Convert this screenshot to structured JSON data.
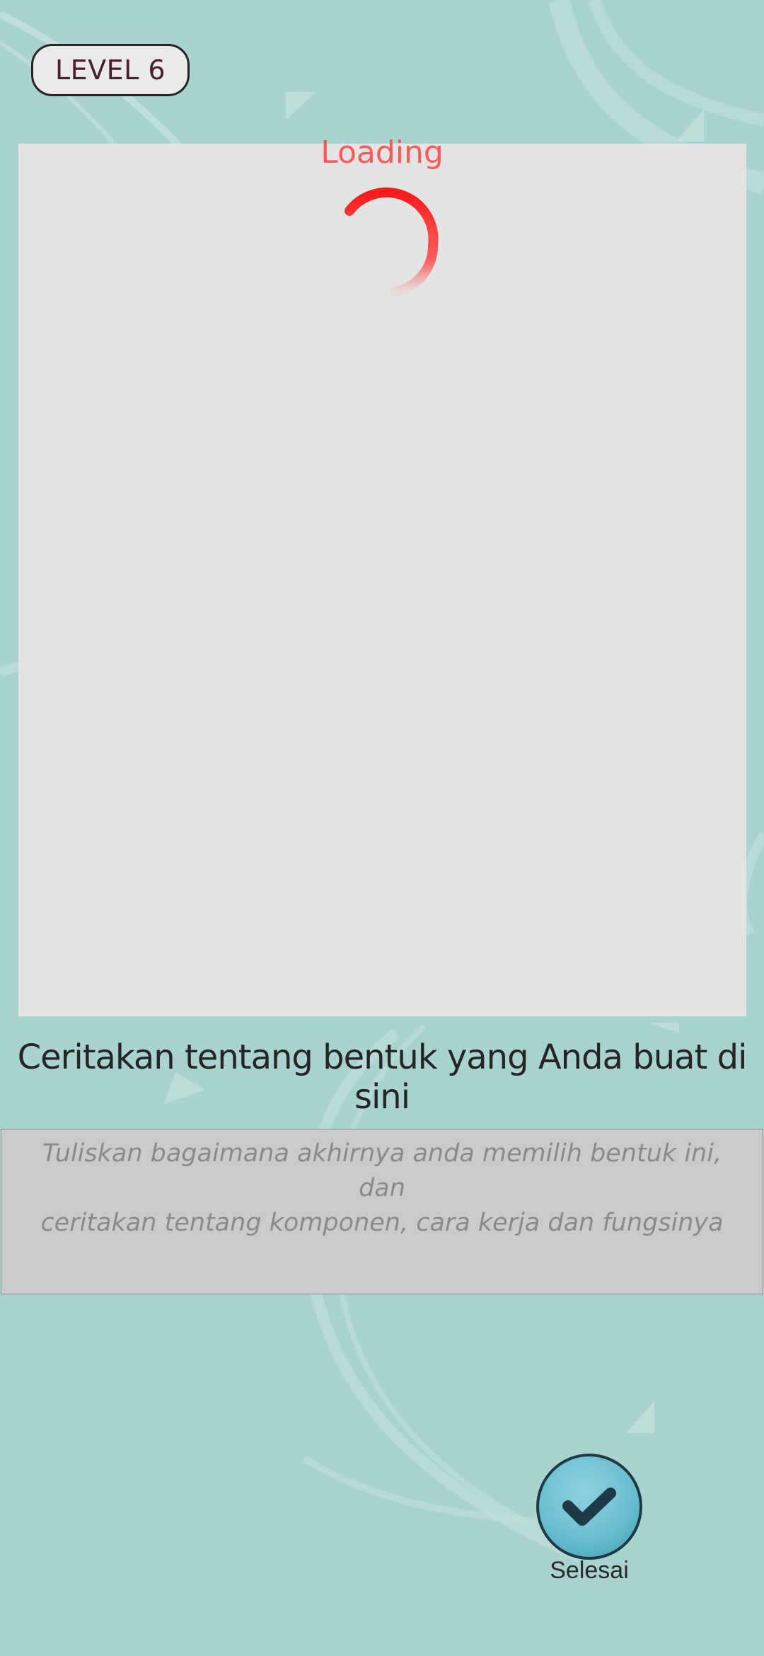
{
  "level": {
    "label": "LEVEL 6"
  },
  "canvas": {
    "loading_text": "Loading"
  },
  "prompt": {
    "text": "Ceritakan tentang bentuk yang Anda buat di sini"
  },
  "answer": {
    "placeholder_line1": "Tuliskan bagaimana akhirnya anda memilih bentuk ini, dan",
    "placeholder_line2": "ceritakan tentang komponen, cara kerja dan fungsinya",
    "value": ""
  },
  "done": {
    "label": "Selesai",
    "icon": "checkmark-icon"
  },
  "colors": {
    "background": "#a9d3cf",
    "canvas": "#e4e4e4",
    "loading": "#ff5a5a",
    "spinner": "#ff1a1a",
    "button": "#6bbfd1"
  }
}
